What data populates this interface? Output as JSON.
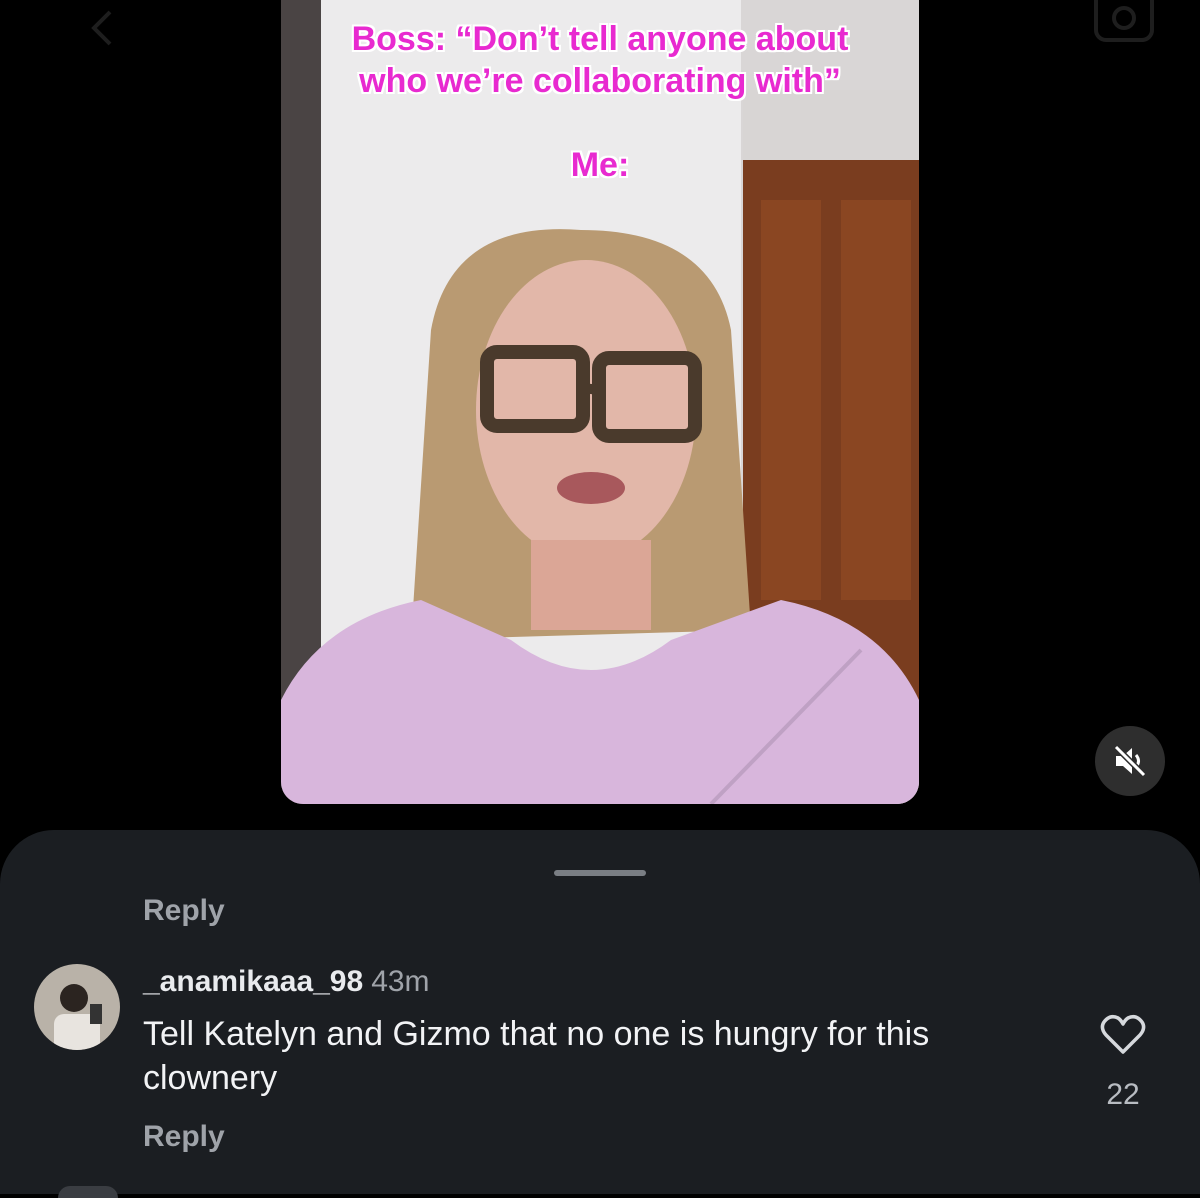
{
  "video": {
    "caption_line1": "Boss: “Don’t tell anyone about",
    "caption_line2": "who we’re collaborating with”",
    "caption_line3": "Me:"
  },
  "icons": {
    "mute": "speaker-muted-icon",
    "like": "heart-outline-icon",
    "back": "chevron-left-icon",
    "camera": "camera-icon"
  },
  "colors": {
    "caption": "#e82ad0",
    "sheet_bg": "#1b1e22",
    "secondary_text": "#9fa3a9"
  },
  "comments": {
    "top_reply_label": "Reply",
    "items": [
      {
        "username": "_anamikaaa_98",
        "time": "43m",
        "text": "Tell Katelyn and Gizmo that no one is hungry for this clownery",
        "likes": "22",
        "reply_label": "Reply"
      }
    ]
  }
}
